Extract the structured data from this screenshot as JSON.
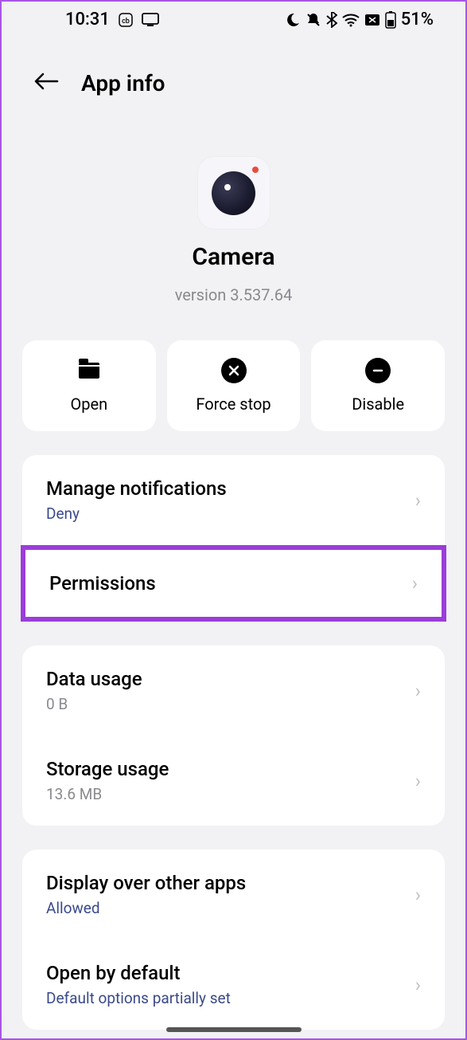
{
  "status": {
    "time": "10:31",
    "battery": "51%"
  },
  "header": {
    "title": "App info"
  },
  "app": {
    "name": "Camera",
    "version": "version 3.537.64"
  },
  "actions": {
    "open": "Open",
    "force_stop": "Force stop",
    "disable": "Disable"
  },
  "settings1": {
    "notifications": {
      "title": "Manage notifications",
      "sub": "Deny"
    },
    "permissions": {
      "title": "Permissions"
    }
  },
  "settings2": {
    "data": {
      "title": "Data usage",
      "sub": "0 B"
    },
    "storage": {
      "title": "Storage usage",
      "sub": "13.6 MB"
    }
  },
  "settings3": {
    "display_over": {
      "title": "Display over other apps",
      "sub": "Allowed"
    },
    "open_default": {
      "title": "Open by default",
      "sub": "Default options partially set"
    }
  }
}
